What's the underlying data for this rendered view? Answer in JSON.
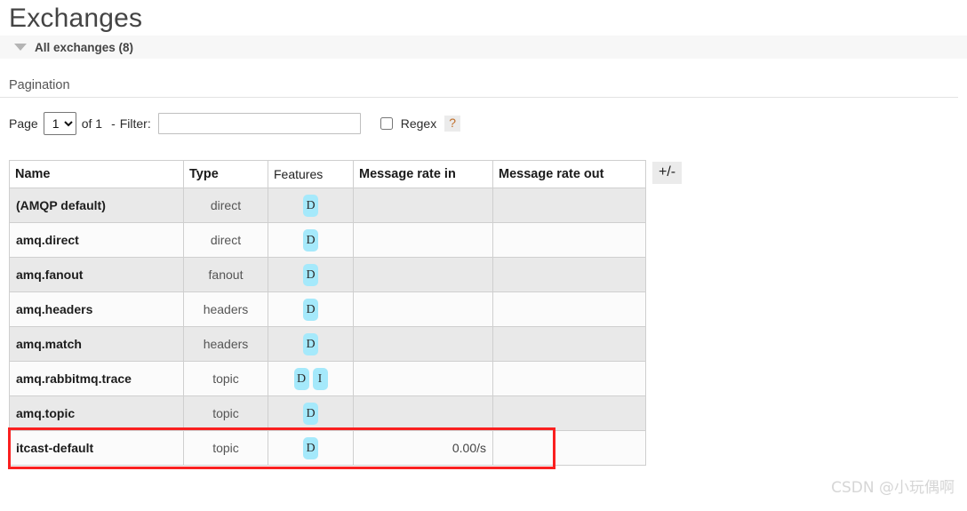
{
  "page": {
    "title": "Exchanges",
    "section": {
      "label": "All exchanges (8)",
      "toggle_icon": "triangle-down-icon"
    }
  },
  "pagination": {
    "heading": "Pagination",
    "page_label": "Page",
    "page_value": "1",
    "page_options": [
      "1"
    ],
    "of_label": "of 1",
    "separator": "-",
    "filter_label": "Filter:",
    "filter_value": "",
    "filter_placeholder": "",
    "regex_label": "Regex",
    "regex_checked": false,
    "help_label": "?"
  },
  "table": {
    "columns": [
      "Name",
      "Type",
      "Features",
      "Message rate in",
      "Message rate out"
    ],
    "column_toggle_label": "+/-",
    "rows": [
      {
        "name": "(AMQP default)",
        "type": "direct",
        "features": [
          "D"
        ],
        "rate_in": "",
        "rate_out": "",
        "highlighted": false
      },
      {
        "name": "amq.direct",
        "type": "direct",
        "features": [
          "D"
        ],
        "rate_in": "",
        "rate_out": "",
        "highlighted": false
      },
      {
        "name": "amq.fanout",
        "type": "fanout",
        "features": [
          "D"
        ],
        "rate_in": "",
        "rate_out": "",
        "highlighted": false
      },
      {
        "name": "amq.headers",
        "type": "headers",
        "features": [
          "D"
        ],
        "rate_in": "",
        "rate_out": "",
        "highlighted": false
      },
      {
        "name": "amq.match",
        "type": "headers",
        "features": [
          "D"
        ],
        "rate_in": "",
        "rate_out": "",
        "highlighted": false
      },
      {
        "name": "amq.rabbitmq.trace",
        "type": "topic",
        "features": [
          "D",
          "I"
        ],
        "rate_in": "",
        "rate_out": "",
        "highlighted": false
      },
      {
        "name": "amq.topic",
        "type": "topic",
        "features": [
          "D"
        ],
        "rate_in": "",
        "rate_out": "",
        "highlighted": false
      },
      {
        "name": "itcast-default",
        "type": "topic",
        "features": [
          "D"
        ],
        "rate_in": "0.00/s",
        "rate_out": "",
        "highlighted": true
      }
    ]
  },
  "annotation": {
    "highlight_color": "#fa2020"
  },
  "watermark": {
    "text": "CSDN @小玩偶啊"
  },
  "colors": {
    "badge_bg": "#a5e9fb",
    "section_bg": "#f7f7f7",
    "row_odd": "#e9e9e9",
    "row_even": "#fbfbfb"
  }
}
